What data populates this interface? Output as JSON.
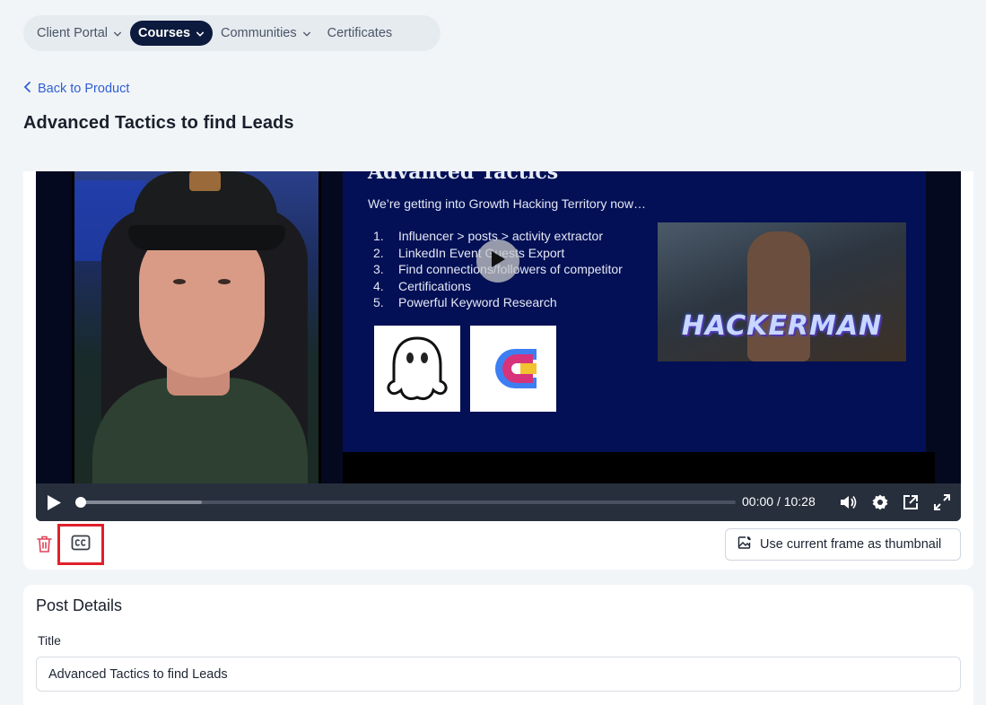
{
  "nav": {
    "items": [
      {
        "label": "Client Portal",
        "active": false,
        "has_dropdown": true
      },
      {
        "label": "Courses",
        "active": true,
        "has_dropdown": true
      },
      {
        "label": "Communities",
        "active": false,
        "has_dropdown": true
      },
      {
        "label": "Certificates",
        "active": false,
        "has_dropdown": false
      }
    ]
  },
  "back_link": "Back to Product",
  "page_title": "Advanced Tactics to find Leads",
  "video": {
    "slide": {
      "heading": "Advanced Tactics",
      "subtitle": "We’re getting into Growth Hacking Territory now…",
      "list": [
        {
          "num": "1.",
          "text": "Influencer > posts > activity extractor"
        },
        {
          "num": "2.",
          "text": "LinkedIn Event Guests Export"
        },
        {
          "num": "3.",
          "text": "Find connections/followers of competitor"
        },
        {
          "num": "4.",
          "text": "Certifications"
        },
        {
          "num": "5.",
          "text": "Powerful Keyword Research"
        }
      ],
      "image_text": "HACKERMAN"
    },
    "current_time": "00:00",
    "separator": "/",
    "duration": "10:28",
    "progress": 0.0,
    "buffered": 0.19
  },
  "actions": {
    "thumbnail_button": "Use current frame as thumbnail"
  },
  "post_details": {
    "heading": "Post Details",
    "title_label": "Title",
    "title_value": "Advanced Tactics to find Leads"
  },
  "colors": {
    "nav_active_bg": "#0b1a3d",
    "link": "#2f5fd0",
    "delete": "#e0455a",
    "highlight_border": "#e0202a",
    "video_controls_bg": "#272f3d",
    "slide_bg": "#031055"
  },
  "icons": [
    "chevron-down-icon",
    "chevron-left-icon",
    "play-icon",
    "volume-icon",
    "gear-icon",
    "popout-icon",
    "fullscreen-icon",
    "trash-icon",
    "closed-captions-icon",
    "image-edit-icon"
  ]
}
